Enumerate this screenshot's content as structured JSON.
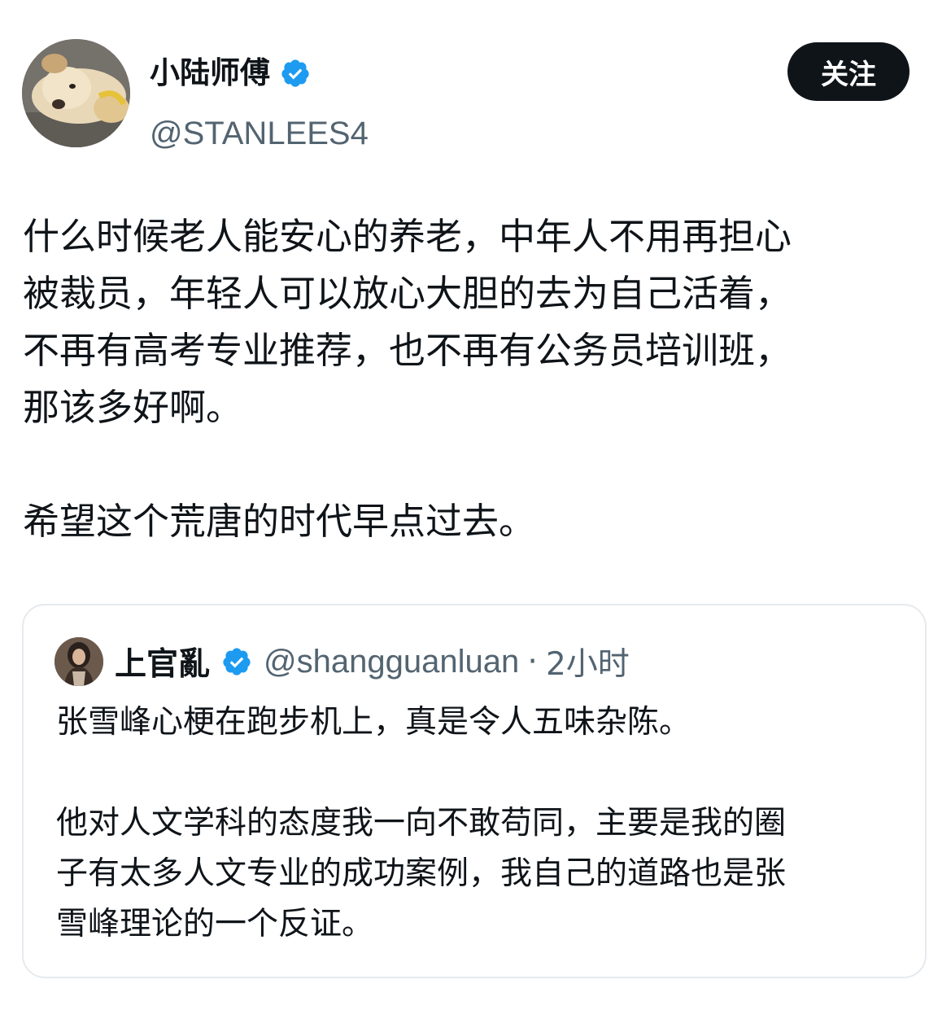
{
  "author": {
    "display_name": "小陆师傅",
    "handle": "@STANLEES4",
    "verified": true,
    "avatar_icon": "avatar-dog-photo"
  },
  "follow_button": {
    "label": "关注"
  },
  "tweet": {
    "paragraph_1_lines": [
      "什么时候老人能安心的养老，中年人不用再担心",
      "被裁员，年轻人可以放心大胆的去为自己活着，",
      "不再有高考专业推荐，也不再有公务员培训班，",
      "那该多好啊。"
    ],
    "paragraph_2": "希望这个荒唐的时代早点过去。"
  },
  "quote": {
    "display_name": "上官亂",
    "verified": true,
    "handle": "@shangguanluan",
    "separator": "·",
    "time": "2小时",
    "paragraph_1": "张雪峰心梗在跑步机上，真是令人五味杂陈。",
    "paragraph_2_lines": [
      "他对人文学科的态度我一向不敢苟同，主要是我的圈",
      "子有太多人文专业的成功案例，我自己的道路也是张",
      "雪峰理论的一个反证。"
    ]
  },
  "colors": {
    "text_primary": "#0f1419",
    "text_secondary": "#536471",
    "verified_blue": "#1d9bf0",
    "button_bg": "#0f1419",
    "card_border": "#e6eaee"
  }
}
